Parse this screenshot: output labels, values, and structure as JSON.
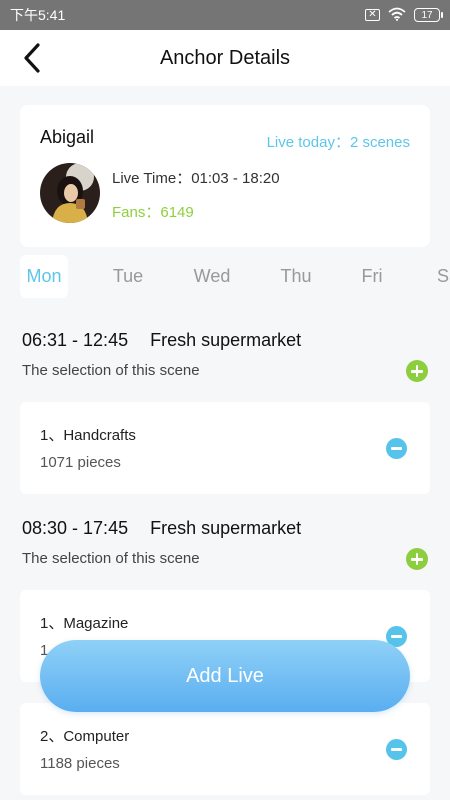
{
  "status_bar": {
    "time": "下午5:41",
    "battery": "17"
  },
  "nav": {
    "title": "Anchor Details"
  },
  "profile": {
    "name": "Abigail",
    "live_today": "Live today：2 scenes",
    "live_time": "Live Time：01:03 - 18:20",
    "fans": "Fans：6149"
  },
  "days": [
    "Mon",
    "Tue",
    "Wed",
    "Thu",
    "Fri",
    "Sa"
  ],
  "selected_day": "Mon",
  "scenes": [
    {
      "time": "06:31 - 12:45",
      "shop": "Fresh supermarket",
      "selection_label": "The selection of this scene",
      "items": [
        {
          "name": "1、Handcrafts",
          "qty": "1071 pieces"
        }
      ]
    },
    {
      "time": "08:30 - 17:45",
      "shop": "Fresh supermarket",
      "selection_label": "The selection of this scene",
      "items": [
        {
          "name": "1、Magazine",
          "qty": "1"
        },
        {
          "name": "2、Computer",
          "qty": "1188 pieces"
        }
      ]
    }
  ],
  "add_live_label": "Add Live",
  "colors": {
    "accent_blue": "#5cc6ea",
    "accent_green": "#8fcf3c",
    "background": "#f6f7f9"
  }
}
